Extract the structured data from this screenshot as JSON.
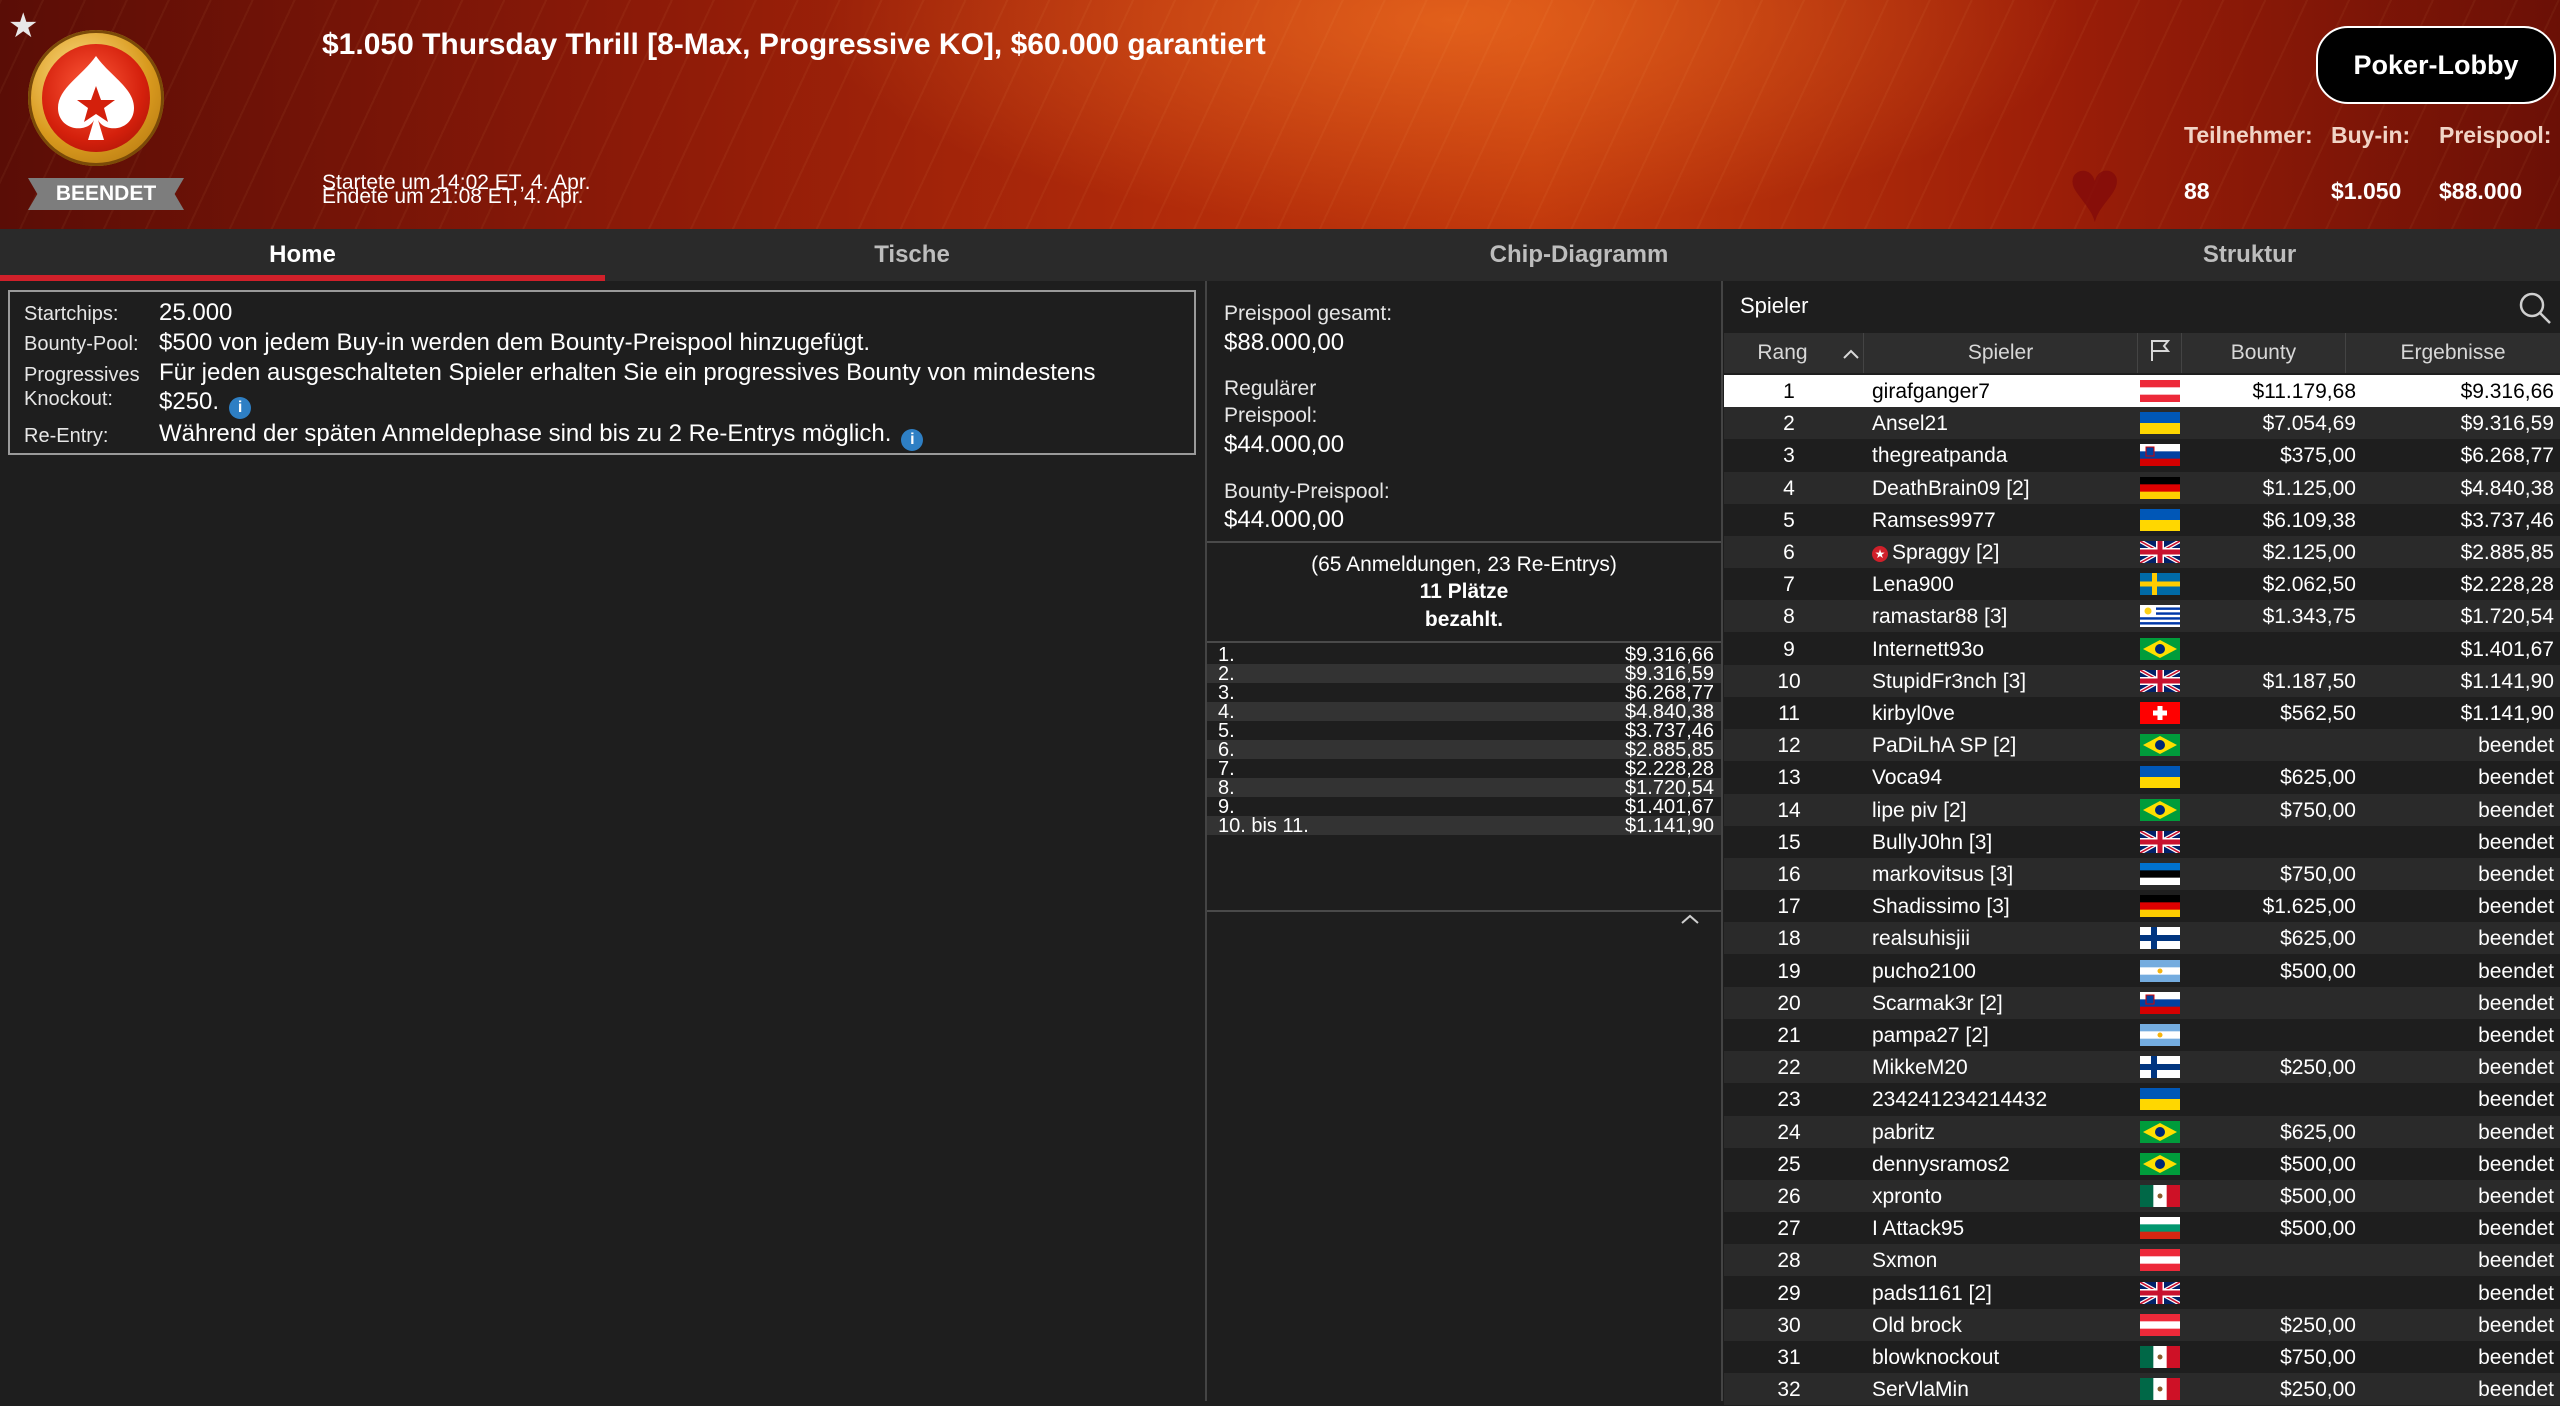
{
  "header": {
    "title": "$1.050 Thursday Thrill [8-Max, Progressive KO], $60.000 garantiert",
    "status": "BEENDET",
    "started": "Startete um 14:02 ET, 4. Apr.",
    "ended": "Endete um 21:08 ET, 4. Apr.",
    "lobby_button": "Poker-Lobby",
    "stats": {
      "participants_label": "Teilnehmer:",
      "participants_value": "88",
      "buyin_label": "Buy-in:",
      "buyin_value": "$1.050",
      "prizepool_label": "Preispool:",
      "prizepool_value": "$88.000"
    }
  },
  "tabs": [
    "Home",
    "Tische",
    "Chip-Diagramm",
    "Struktur"
  ],
  "info": {
    "startchips_label": "Startchips:",
    "startchips_value": "25.000",
    "bountypool_label": "Bounty-Pool:",
    "bountypool_value": "$500 von jedem Buy-in werden dem Bounty-Preispool hinzugefügt.",
    "ko_label_1": "Progressives",
    "ko_label_2": "Knockout:",
    "ko_value_1": "Für jeden ausgeschalteten Spieler erhalten Sie ein progressives Bounty von mindestens",
    "ko_value_2": "$250.",
    "reentry_label": "Re-Entry:",
    "reentry_value": "Während der späten Anmeldephase sind bis zu 2 Re-Entrys möglich.",
    "info_glyph": "i"
  },
  "prizepool": {
    "total_label": "Preispool gesamt:",
    "total_value": "$88.000,00",
    "regular_label_1": "Regulärer",
    "regular_label_2": "Preispool:",
    "regular_value": "$44.000,00",
    "bounty_label": "Bounty-Preispool:",
    "bounty_value": "$44.000,00",
    "summary_1": "(65 Anmeldungen, 23 Re-Entrys)",
    "summary_2": "11 Plätze",
    "summary_3": "bezahlt.",
    "payouts": [
      {
        "place": "1.",
        "amount": "$9.316,66"
      },
      {
        "place": "2.",
        "amount": "$9.316,59"
      },
      {
        "place": "3.",
        "amount": "$6.268,77"
      },
      {
        "place": "4.",
        "amount": "$4.840,38"
      },
      {
        "place": "5.",
        "amount": "$3.737,46"
      },
      {
        "place": "6.",
        "amount": "$2.885,85"
      },
      {
        "place": "7.",
        "amount": "$2.228,28"
      },
      {
        "place": "8.",
        "amount": "$1.720,54"
      },
      {
        "place": "9.",
        "amount": "$1.401,67"
      },
      {
        "place": "10. bis 11.",
        "amount": "$1.141,90"
      }
    ]
  },
  "players": {
    "title": "Spieler",
    "columns": {
      "rank": "Rang",
      "player": "Spieler",
      "bounty": "Bounty",
      "result": "Ergebnisse"
    },
    "rows": [
      {
        "rank": "1",
        "name": "girafganger7",
        "flag": "austria",
        "bounty": "$11.179,68",
        "result": "$9.316,66"
      },
      {
        "rank": "2",
        "name": "Ansel21",
        "flag": "ukraine",
        "bounty": "$7.054,69",
        "result": "$9.316,59"
      },
      {
        "rank": "3",
        "name": "thegreatpanda",
        "flag": "slovenia",
        "bounty": "$375,00",
        "result": "$6.268,77"
      },
      {
        "rank": "4",
        "name": "DeathBrain09 [2]",
        "flag": "germany",
        "bounty": "$1.125,00",
        "result": "$4.840,38"
      },
      {
        "rank": "5",
        "name": "Ramses9977",
        "flag": "ukraine",
        "bounty": "$6.109,38",
        "result": "$3.737,46"
      },
      {
        "rank": "6",
        "name": "Spraggy [2]",
        "flag": "uk",
        "bounty": "$2.125,00",
        "result": "$2.885,85",
        "pro": true
      },
      {
        "rank": "7",
        "name": "Lena900",
        "flag": "sweden",
        "bounty": "$2.062,50",
        "result": "$2.228,28"
      },
      {
        "rank": "8",
        "name": "ramastar88 [3]",
        "flag": "uruguay",
        "bounty": "$1.343,75",
        "result": "$1.720,54"
      },
      {
        "rank": "9",
        "name": "Internett93o",
        "flag": "brazil",
        "bounty": "",
        "result": "$1.401,67"
      },
      {
        "rank": "10",
        "name": "StupidFr3nch [3]",
        "flag": "uk",
        "bounty": "$1.187,50",
        "result": "$1.141,90"
      },
      {
        "rank": "11",
        "name": "kirbyl0ve",
        "flag": "switzerland",
        "bounty": "$562,50",
        "result": "$1.141,90"
      },
      {
        "rank": "12",
        "name": "PaDiLhA SP [2]",
        "flag": "brazil",
        "bounty": "",
        "result": "beendet"
      },
      {
        "rank": "13",
        "name": "Voca94",
        "flag": "ukraine",
        "bounty": "$625,00",
        "result": "beendet"
      },
      {
        "rank": "14",
        "name": "lipe piv [2]",
        "flag": "brazil",
        "bounty": "$750,00",
        "result": "beendet"
      },
      {
        "rank": "15",
        "name": "BullyJ0hn [3]",
        "flag": "uk",
        "bounty": "",
        "result": "beendet"
      },
      {
        "rank": "16",
        "name": "markovitsus [3]",
        "flag": "estonia",
        "bounty": "$750,00",
        "result": "beendet"
      },
      {
        "rank": "17",
        "name": "Shadissimo [3]",
        "flag": "germany",
        "bounty": "$1.625,00",
        "result": "beendet"
      },
      {
        "rank": "18",
        "name": "realsuhisjii",
        "flag": "finland",
        "bounty": "$625,00",
        "result": "beendet"
      },
      {
        "rank": "19",
        "name": "pucho2100",
        "flag": "argentina",
        "bounty": "$500,00",
        "result": "beendet"
      },
      {
        "rank": "20",
        "name": "Scarmak3r [2]",
        "flag": "slovenia",
        "bounty": "",
        "result": "beendet"
      },
      {
        "rank": "21",
        "name": "pampa27 [2]",
        "flag": "argentina",
        "bounty": "",
        "result": "beendet"
      },
      {
        "rank": "22",
        "name": "MikkeM20",
        "flag": "finland",
        "bounty": "$250,00",
        "result": "beendet"
      },
      {
        "rank": "23",
        "name": "234241234214432",
        "flag": "ukraine",
        "bounty": "",
        "result": "beendet"
      },
      {
        "rank": "24",
        "name": "pabritz",
        "flag": "brazil",
        "bounty": "$625,00",
        "result": "beendet"
      },
      {
        "rank": "25",
        "name": "dennysramos2",
        "flag": "brazil",
        "bounty": "$500,00",
        "result": "beendet"
      },
      {
        "rank": "26",
        "name": "xpronto",
        "flag": "mexico",
        "bounty": "$500,00",
        "result": "beendet"
      },
      {
        "rank": "27",
        "name": "I Attack95",
        "flag": "bulgaria",
        "bounty": "$500,00",
        "result": "beendet"
      },
      {
        "rank": "28",
        "name": "Sxmon",
        "flag": "austria",
        "bounty": "",
        "result": "beendet"
      },
      {
        "rank": "29",
        "name": "pads1161 [2]",
        "flag": "uk",
        "bounty": "",
        "result": "beendet"
      },
      {
        "rank": "30",
        "name": "Old brock",
        "flag": "austria",
        "bounty": "$250,00",
        "result": "beendet"
      },
      {
        "rank": "31",
        "name": "blowknockout",
        "flag": "mexico",
        "bounty": "$750,00",
        "result": "beendet"
      },
      {
        "rank": "32",
        "name": "SerVlaMin",
        "flag": "mexico",
        "bounty": "$250,00",
        "result": "beendet"
      }
    ]
  },
  "colors": {
    "accent": "#d0202a",
    "header_red": "#b02a0a",
    "background": "#1e1e1e",
    "selected_row": "#ffffff"
  },
  "icons": [
    "star-icon",
    "pokerstars-logo",
    "search-icon",
    "sort-up-icon",
    "flag-column-icon",
    "info-icon",
    "chevron-up-icon",
    "pro-badge-icon"
  ]
}
